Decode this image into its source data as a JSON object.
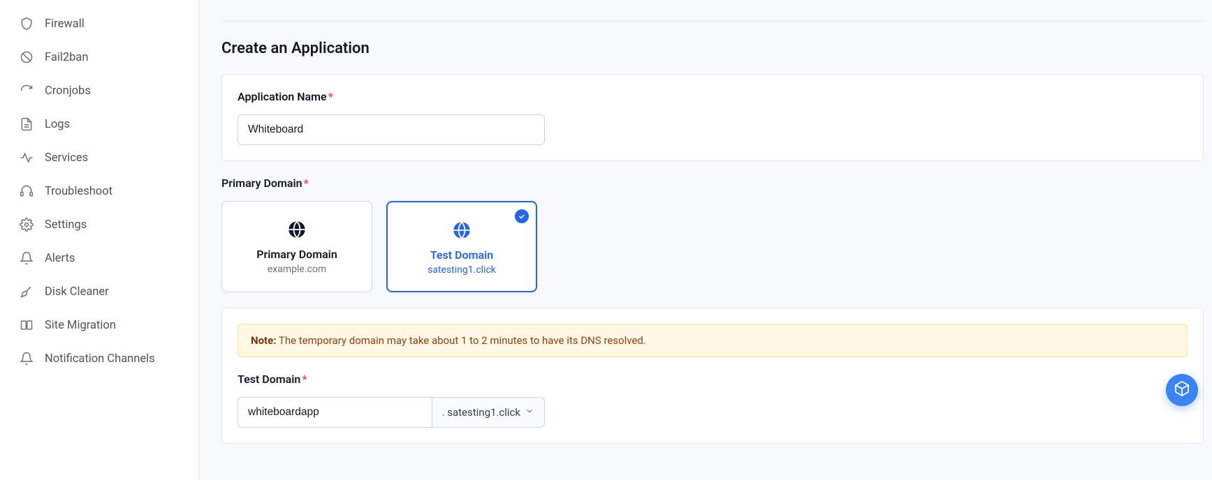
{
  "sidebar": {
    "items": [
      {
        "label": "Firewall",
        "icon": "shield-icon"
      },
      {
        "label": "Fail2ban",
        "icon": "ban-icon"
      },
      {
        "label": "Cronjobs",
        "icon": "refresh-icon"
      },
      {
        "label": "Logs",
        "icon": "document-icon"
      },
      {
        "label": "Services",
        "icon": "heartbeat-icon"
      },
      {
        "label": "Troubleshoot",
        "icon": "headset-icon"
      },
      {
        "label": "Settings",
        "icon": "gear-icon"
      },
      {
        "label": "Alerts",
        "icon": "bell-icon"
      },
      {
        "label": "Disk Cleaner",
        "icon": "broom-icon"
      },
      {
        "label": "Site Migration",
        "icon": "panels-icon"
      },
      {
        "label": "Notification Channels",
        "icon": "bell-icon"
      }
    ]
  },
  "page": {
    "title": "Create an Application"
  },
  "app_name": {
    "label": "Application Name",
    "value": "Whiteboard"
  },
  "primary_domain": {
    "label": "Primary Domain",
    "options": [
      {
        "title": "Primary Domain",
        "subtitle": "example.com",
        "selected": false
      },
      {
        "title": "Test Domain",
        "subtitle": "satesting1.click",
        "selected": true
      }
    ]
  },
  "note": {
    "prefix": "Note:",
    "text": "The temporary domain may take about 1 to 2 minutes to have its DNS resolved."
  },
  "test_domain": {
    "label": "Test Domain",
    "value": "whiteboardapp",
    "suffix": ". satesting1.click"
  }
}
